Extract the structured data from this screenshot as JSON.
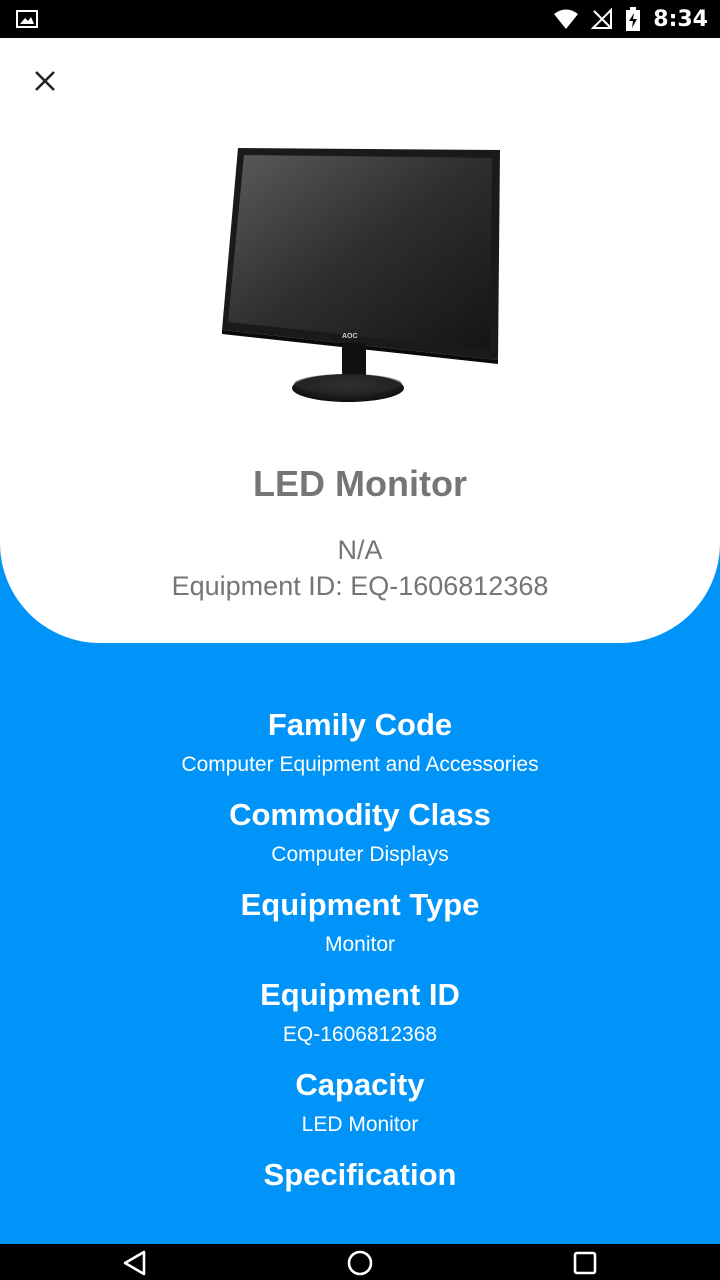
{
  "status_bar": {
    "time": "8:34"
  },
  "product": {
    "title": "LED Monitor",
    "subtitle": "N/A",
    "equipment_id_line": "Equipment ID: EQ-1606812368"
  },
  "details": [
    {
      "label": "Family Code",
      "value": "Computer Equipment and Accessories"
    },
    {
      "label": "Commodity Class",
      "value": "Computer Displays"
    },
    {
      "label": "Equipment Type",
      "value": "Monitor"
    },
    {
      "label": "Equipment ID",
      "value": "EQ-1606812368"
    },
    {
      "label": "Capacity",
      "value": "LED Monitor"
    },
    {
      "label": "Specification",
      "value": ""
    }
  ],
  "image_brand": "AOC"
}
